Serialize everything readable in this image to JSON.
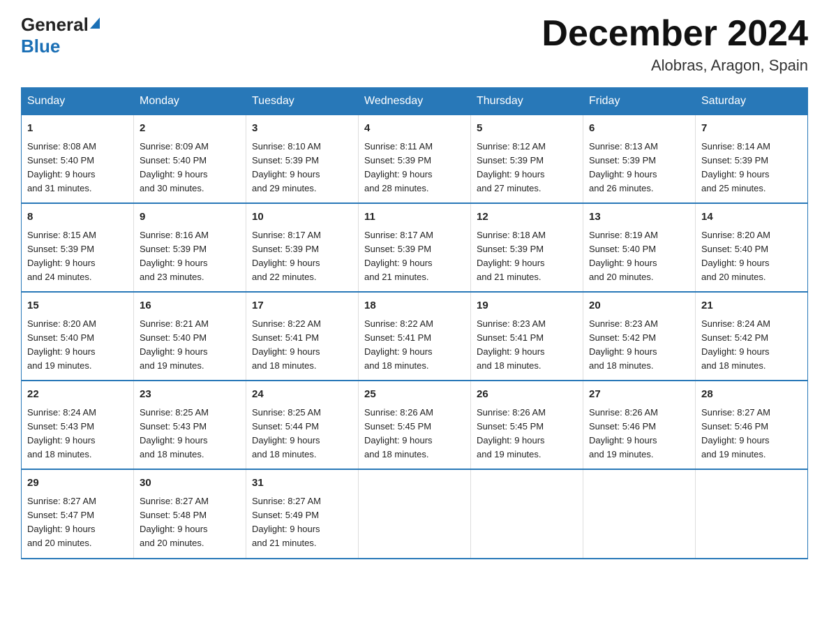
{
  "header": {
    "logo_general": "General",
    "logo_blue": "Blue",
    "month_title": "December 2024",
    "location": "Alobras, Aragon, Spain"
  },
  "days_of_week": [
    "Sunday",
    "Monday",
    "Tuesday",
    "Wednesday",
    "Thursday",
    "Friday",
    "Saturday"
  ],
  "weeks": [
    [
      {
        "day": "1",
        "sunrise": "8:08 AM",
        "sunset": "5:40 PM",
        "daylight": "9 hours and 31 minutes."
      },
      {
        "day": "2",
        "sunrise": "8:09 AM",
        "sunset": "5:40 PM",
        "daylight": "9 hours and 30 minutes."
      },
      {
        "day": "3",
        "sunrise": "8:10 AM",
        "sunset": "5:39 PM",
        "daylight": "9 hours and 29 minutes."
      },
      {
        "day": "4",
        "sunrise": "8:11 AM",
        "sunset": "5:39 PM",
        "daylight": "9 hours and 28 minutes."
      },
      {
        "day": "5",
        "sunrise": "8:12 AM",
        "sunset": "5:39 PM",
        "daylight": "9 hours and 27 minutes."
      },
      {
        "day": "6",
        "sunrise": "8:13 AM",
        "sunset": "5:39 PM",
        "daylight": "9 hours and 26 minutes."
      },
      {
        "day": "7",
        "sunrise": "8:14 AM",
        "sunset": "5:39 PM",
        "daylight": "9 hours and 25 minutes."
      }
    ],
    [
      {
        "day": "8",
        "sunrise": "8:15 AM",
        "sunset": "5:39 PM",
        "daylight": "9 hours and 24 minutes."
      },
      {
        "day": "9",
        "sunrise": "8:16 AM",
        "sunset": "5:39 PM",
        "daylight": "9 hours and 23 minutes."
      },
      {
        "day": "10",
        "sunrise": "8:17 AM",
        "sunset": "5:39 PM",
        "daylight": "9 hours and 22 minutes."
      },
      {
        "day": "11",
        "sunrise": "8:17 AM",
        "sunset": "5:39 PM",
        "daylight": "9 hours and 21 minutes."
      },
      {
        "day": "12",
        "sunrise": "8:18 AM",
        "sunset": "5:39 PM",
        "daylight": "9 hours and 21 minutes."
      },
      {
        "day": "13",
        "sunrise": "8:19 AM",
        "sunset": "5:40 PM",
        "daylight": "9 hours and 20 minutes."
      },
      {
        "day": "14",
        "sunrise": "8:20 AM",
        "sunset": "5:40 PM",
        "daylight": "9 hours and 20 minutes."
      }
    ],
    [
      {
        "day": "15",
        "sunrise": "8:20 AM",
        "sunset": "5:40 PM",
        "daylight": "9 hours and 19 minutes."
      },
      {
        "day": "16",
        "sunrise": "8:21 AM",
        "sunset": "5:40 PM",
        "daylight": "9 hours and 19 minutes."
      },
      {
        "day": "17",
        "sunrise": "8:22 AM",
        "sunset": "5:41 PM",
        "daylight": "9 hours and 18 minutes."
      },
      {
        "day": "18",
        "sunrise": "8:22 AM",
        "sunset": "5:41 PM",
        "daylight": "9 hours and 18 minutes."
      },
      {
        "day": "19",
        "sunrise": "8:23 AM",
        "sunset": "5:41 PM",
        "daylight": "9 hours and 18 minutes."
      },
      {
        "day": "20",
        "sunrise": "8:23 AM",
        "sunset": "5:42 PM",
        "daylight": "9 hours and 18 minutes."
      },
      {
        "day": "21",
        "sunrise": "8:24 AM",
        "sunset": "5:42 PM",
        "daylight": "9 hours and 18 minutes."
      }
    ],
    [
      {
        "day": "22",
        "sunrise": "8:24 AM",
        "sunset": "5:43 PM",
        "daylight": "9 hours and 18 minutes."
      },
      {
        "day": "23",
        "sunrise": "8:25 AM",
        "sunset": "5:43 PM",
        "daylight": "9 hours and 18 minutes."
      },
      {
        "day": "24",
        "sunrise": "8:25 AM",
        "sunset": "5:44 PM",
        "daylight": "9 hours and 18 minutes."
      },
      {
        "day": "25",
        "sunrise": "8:26 AM",
        "sunset": "5:45 PM",
        "daylight": "9 hours and 18 minutes."
      },
      {
        "day": "26",
        "sunrise": "8:26 AM",
        "sunset": "5:45 PM",
        "daylight": "9 hours and 19 minutes."
      },
      {
        "day": "27",
        "sunrise": "8:26 AM",
        "sunset": "5:46 PM",
        "daylight": "9 hours and 19 minutes."
      },
      {
        "day": "28",
        "sunrise": "8:27 AM",
        "sunset": "5:46 PM",
        "daylight": "9 hours and 19 minutes."
      }
    ],
    [
      {
        "day": "29",
        "sunrise": "8:27 AM",
        "sunset": "5:47 PM",
        "daylight": "9 hours and 20 minutes."
      },
      {
        "day": "30",
        "sunrise": "8:27 AM",
        "sunset": "5:48 PM",
        "daylight": "9 hours and 20 minutes."
      },
      {
        "day": "31",
        "sunrise": "8:27 AM",
        "sunset": "5:49 PM",
        "daylight": "9 hours and 21 minutes."
      },
      null,
      null,
      null,
      null
    ]
  ],
  "labels": {
    "sunrise": "Sunrise:",
    "sunset": "Sunset:",
    "daylight": "Daylight:"
  }
}
